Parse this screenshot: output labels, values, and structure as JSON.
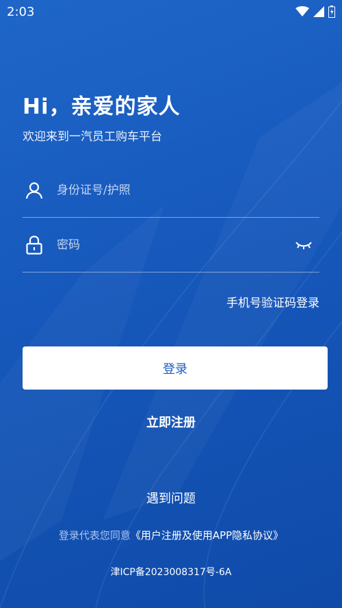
{
  "status_bar": {
    "time": "2:03",
    "icons": [
      "wifi-icon",
      "signal-icon",
      "battery-icon"
    ]
  },
  "header": {
    "greeting": "Hi，亲爱的家人",
    "subtitle": "欢迎来到一汽员工购车平台"
  },
  "form": {
    "id_field": {
      "placeholder": "身份证号/护照",
      "value": "",
      "icon": "user-icon"
    },
    "password_field": {
      "placeholder": "密码",
      "value": "",
      "icon": "lock-icon",
      "toggle_icon": "eye-closed-icon"
    },
    "sms_login_label": "手机号验证码登录",
    "login_label": "登录",
    "register_label": "立即注册"
  },
  "footer": {
    "help_label": "遇到问题",
    "agreement_prefix": "登录代表您同意",
    "agreement_link": "《用户注册及使用APP隐私协议》",
    "icp": "津ICP备2023008317号-6A"
  },
  "colors": {
    "background": "#1658bb",
    "button_bg": "#ffffff",
    "button_text": "#1b5cc2",
    "muted_text": "#a9c6f0"
  }
}
